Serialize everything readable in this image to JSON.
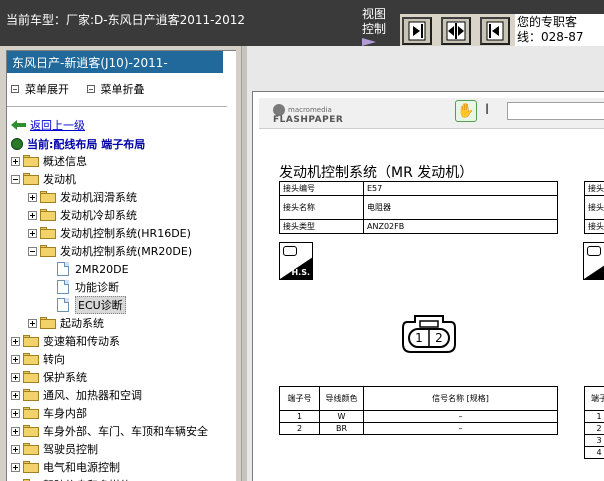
{
  "topbar": {
    "title": "当前车型：厂家:D-东风日产逍客2011-2012",
    "view_label": "视图控制",
    "help_line1": "您的专职客",
    "help_line2": "线：028-87"
  },
  "nav_buttons": [
    "next-page-icon",
    "fit-page-icon",
    "prev-page-icon"
  ],
  "sidebar": {
    "header": "东风日产-新逍客(J10)-2011-",
    "expand_label": "菜单展开",
    "collapse_label": "菜单折叠",
    "back_label": "返回上一级",
    "current_label": "当前:配线布局 端子布局"
  },
  "tree": [
    {
      "label": "概述信息",
      "level": 0,
      "type": "folder",
      "expand": "plus"
    },
    {
      "label": "发动机",
      "level": 0,
      "type": "folder",
      "expand": "minus"
    },
    {
      "label": "发动机润滑系统",
      "level": 1,
      "type": "folder",
      "expand": "plus"
    },
    {
      "label": "发动机冷却系统",
      "level": 1,
      "type": "folder",
      "expand": "plus"
    },
    {
      "label": "发动机控制系统(HR16DE)",
      "level": 1,
      "type": "folder",
      "expand": "plus"
    },
    {
      "label": "发动机控制系统(MR20DE)",
      "level": 1,
      "type": "folder",
      "expand": "minus"
    },
    {
      "label": "2MR20DE",
      "level": 2,
      "type": "doc"
    },
    {
      "label": "功能诊断",
      "level": 2,
      "type": "doc"
    },
    {
      "label": "ECU诊断",
      "level": 2,
      "type": "doc",
      "selected": true
    },
    {
      "label": "起动系统",
      "level": 1,
      "type": "folder",
      "expand": "plus"
    },
    {
      "label": "变速箱和传动系",
      "level": 0,
      "type": "folder",
      "expand": "plus"
    },
    {
      "label": "转向",
      "level": 0,
      "type": "folder",
      "expand": "plus"
    },
    {
      "label": "保护系统",
      "level": 0,
      "type": "folder",
      "expand": "plus"
    },
    {
      "label": "通风、加热器和空调",
      "level": 0,
      "type": "folder",
      "expand": "plus"
    },
    {
      "label": "车身内部",
      "level": 0,
      "type": "folder",
      "expand": "plus"
    },
    {
      "label": "车身外部、车门、车顶和车辆安全",
      "level": 0,
      "type": "folder",
      "expand": "plus"
    },
    {
      "label": "驾驶员控制",
      "level": 0,
      "type": "folder",
      "expand": "plus"
    },
    {
      "label": "电气和电源控制",
      "level": 0,
      "type": "folder",
      "expand": "plus"
    },
    {
      "label": "驾驶信息和多媒体",
      "level": 0,
      "type": "folder",
      "expand": "plus"
    }
  ],
  "viewer": {
    "logo_small": "macromedia",
    "logo_big": "FLASHPAPER",
    "doc_title": "发动机控制系统（MR 发动机）",
    "connector_no_label": "接头编号",
    "connector_no": "E57",
    "connector_name_label": "接头名称",
    "connector_name": "电阻器",
    "connector_type_label": "接头类型",
    "connector_type": "ANZ02FB",
    "right_labels": [
      "接头",
      "接头",
      "接头"
    ],
    "hs_label": "H.S.",
    "pin_labels": [
      "1",
      "2"
    ],
    "pin_table_headers": [
      "端子号",
      "导线颜色",
      "信号名称 [规格]"
    ],
    "pin_rows": [
      {
        "pin": "1",
        "color": "W",
        "signal": "–"
      },
      {
        "pin": "2",
        "color": "BR",
        "signal": "–"
      }
    ],
    "right_pin_header": "端子",
    "right_pin_rows": [
      "1",
      "2",
      "3",
      "4"
    ]
  }
}
